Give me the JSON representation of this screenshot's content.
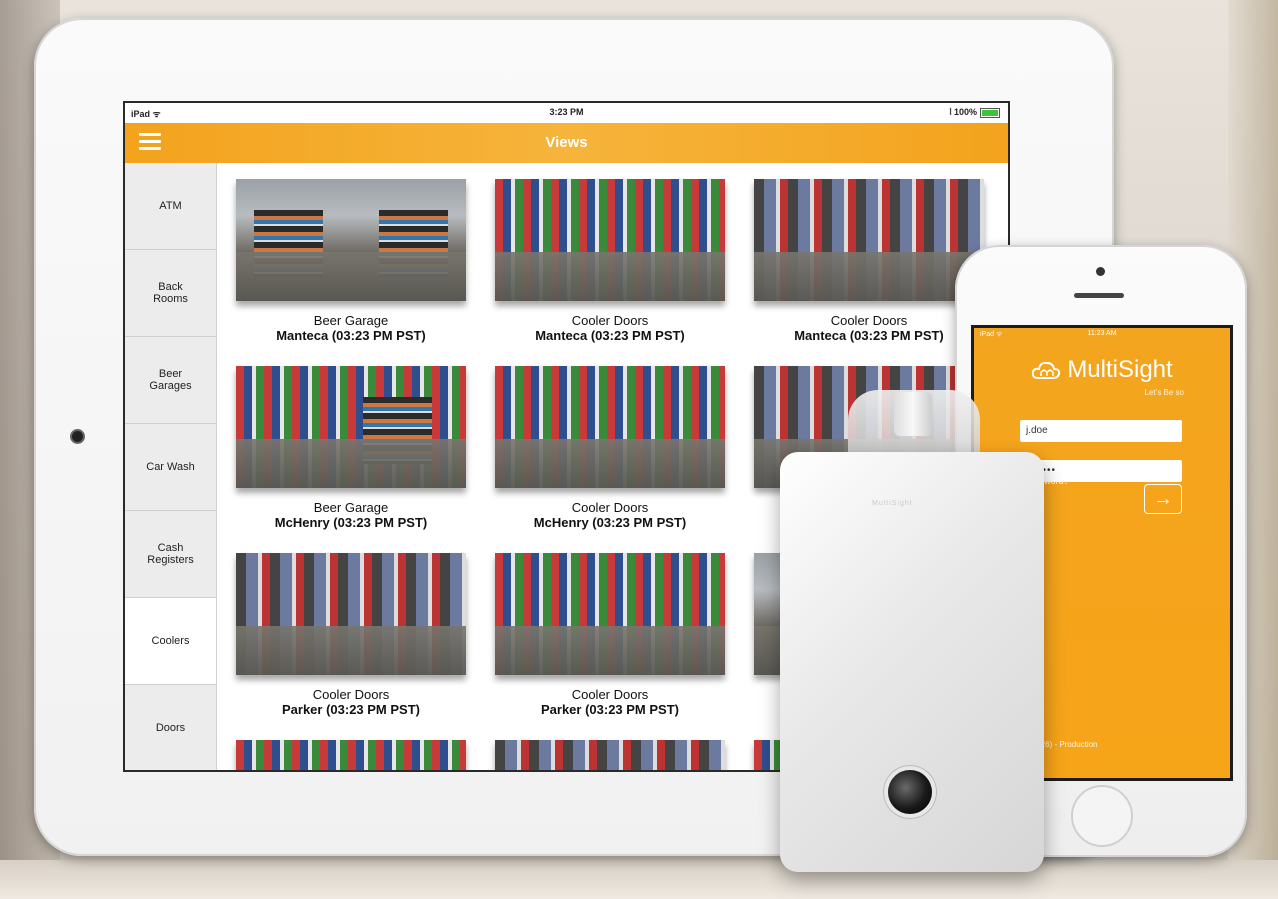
{
  "ipad": {
    "status": {
      "carrier": "iPad ᯤ",
      "time": "3:23 PM",
      "battery": "⦚ 100%"
    },
    "nav": {
      "title": "Views"
    },
    "sidebar": {
      "items": [
        {
          "label": "ATM"
        },
        {
          "label": "Back\nRooms"
        },
        {
          "label": "Beer\nGarages"
        },
        {
          "label": "Car Wash"
        },
        {
          "label": "Cash\nRegisters"
        },
        {
          "label": "Coolers",
          "active": true
        },
        {
          "label": "Doors"
        }
      ]
    },
    "cameras": [
      {
        "name": "Beer Garage",
        "location": "Manteca (03:23 PM PST)"
      },
      {
        "name": "Cooler Doors",
        "location": "Manteca (03:23 PM PST)"
      },
      {
        "name": "Cooler Doors",
        "location": "Manteca (03:23 PM PST)"
      },
      {
        "name": "Beer Garage",
        "location": "McHenry (03:23 PM PST)"
      },
      {
        "name": "Cooler Doors",
        "location": "McHenry (03:23 PM PST)"
      },
      {
        "name": "",
        "location": ""
      },
      {
        "name": "Cooler Doors",
        "location": "Parker (03:23 PM PST)"
      },
      {
        "name": "Cooler Doors",
        "location": "Parker (03:23 PM PST)"
      },
      {
        "name": "",
        "location": ""
      }
    ]
  },
  "iphone": {
    "status": {
      "carrier": "iPad ᯤ",
      "time": "11:23 AM"
    },
    "brand": "MultiSight",
    "tagline": "Let’s Be so",
    "username_value": "j.doe",
    "password_value": "••••••••",
    "forgot_label": "ot Password?",
    "arrow_label": "→",
    "footer": "1.26) - Production"
  },
  "device": {
    "brand": "MultiSight"
  },
  "colors": {
    "accent": "#f3a31d",
    "text": "#111111"
  }
}
